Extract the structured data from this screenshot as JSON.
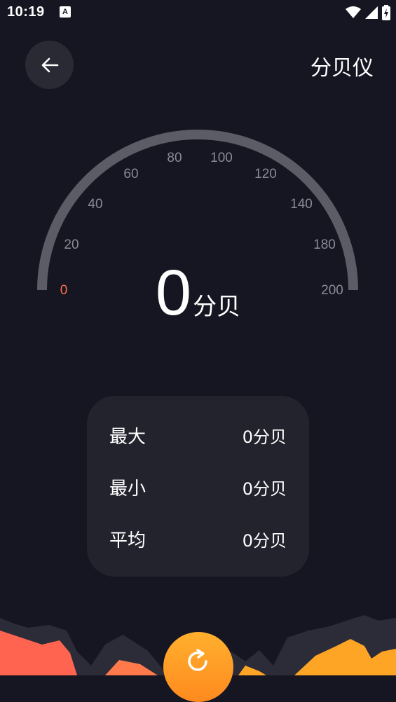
{
  "status": {
    "time": "10:19",
    "notification_icon": "A"
  },
  "header": {
    "title": "分贝仪"
  },
  "gauge": {
    "ticks": [
      "0",
      "20",
      "40",
      "60",
      "80",
      "100",
      "120",
      "140",
      "180",
      "200"
    ],
    "value": "0",
    "unit": "分贝",
    "level_fraction": 0
  },
  "stats": {
    "max": {
      "label": "最大",
      "value": "0分贝"
    },
    "min": {
      "label": "最小",
      "value": "0分贝"
    },
    "avg": {
      "label": "平均",
      "value": "0分贝"
    }
  },
  "colors": {
    "background": "#161622",
    "arc": "#5c5c66",
    "accent_zero": "#ff6b4a",
    "card": "#23232e",
    "button": "#ffa526"
  }
}
